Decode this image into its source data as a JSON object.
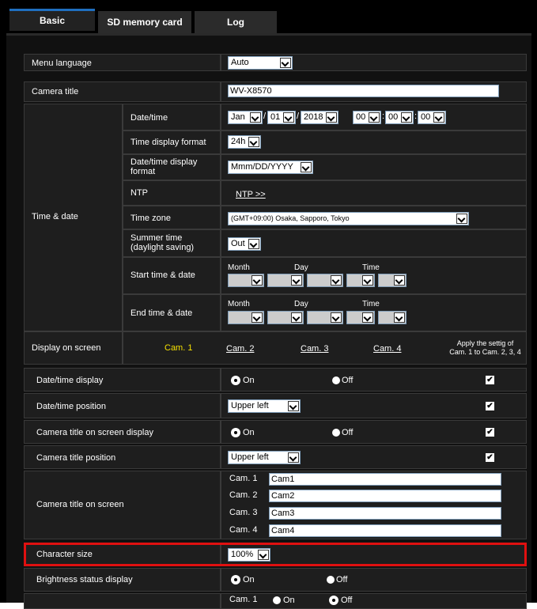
{
  "tabs": [
    "Basic",
    "SD memory card",
    "Log"
  ],
  "menu_language": {
    "label": "Menu language",
    "value": "Auto"
  },
  "camera_title": {
    "label": "Camera title",
    "value": "WV-X8570"
  },
  "time_date": {
    "label": "Time & date",
    "date_time": {
      "label": "Date/time",
      "month": "Jan",
      "day": "01",
      "year": "2018",
      "hour": "00",
      "minute": "00",
      "second": "00"
    },
    "time_display_format": {
      "label": "Time display format",
      "value": "24h"
    },
    "date_time_display_format": {
      "label": "Date/time display format",
      "value": "Mmm/DD/YYYY"
    },
    "ntp": {
      "label": "NTP",
      "link": "NTP >>"
    },
    "time_zone": {
      "label": "Time zone",
      "value": "(GMT+09:00) Osaka, Sapporo, Tokyo"
    },
    "summer_time": {
      "label": "Summer time (daylight saving)",
      "value": "Out"
    },
    "start": {
      "label": "Start time & date",
      "month": "Month",
      "day": "Day",
      "time": "Time"
    },
    "end": {
      "label": "End time & date",
      "month": "Month",
      "day": "Day",
      "time": "Time"
    }
  },
  "display_on_screen": {
    "label": "Display on screen",
    "cams": [
      "Cam. 1",
      "Cam. 2",
      "Cam. 3",
      "Cam. 4"
    ],
    "apply_note_1": "Apply the settig of",
    "apply_note_2": "Cam. 1 to Cam. 2, 3, 4"
  },
  "rows": {
    "datetime_display": {
      "label": "Date/time display",
      "on": "On",
      "off": "Off"
    },
    "datetime_position": {
      "label": "Date/time position",
      "value": "Upper left"
    },
    "camtitle_display": {
      "label": "Camera title on screen display",
      "on": "On",
      "off": "Off"
    },
    "camtitle_position": {
      "label": "Camera title position",
      "value": "Upper left"
    },
    "camtitle_on_screen": {
      "label": "Camera title on screen",
      "cams": [
        {
          "cam": "Cam. 1",
          "value": "Cam1"
        },
        {
          "cam": "Cam. 2",
          "value": "Cam2"
        },
        {
          "cam": "Cam. 3",
          "value": "Cam3"
        },
        {
          "cam": "Cam. 4",
          "value": "Cam4"
        }
      ]
    },
    "character_size": {
      "label": "Character size",
      "value": "100%"
    },
    "brightness": {
      "label": "Brightness status display",
      "on": "On",
      "off": "Off"
    },
    "last": {
      "cam": "Cam. 1",
      "on": "On",
      "off": "Off"
    }
  },
  "check_mark": "✔"
}
